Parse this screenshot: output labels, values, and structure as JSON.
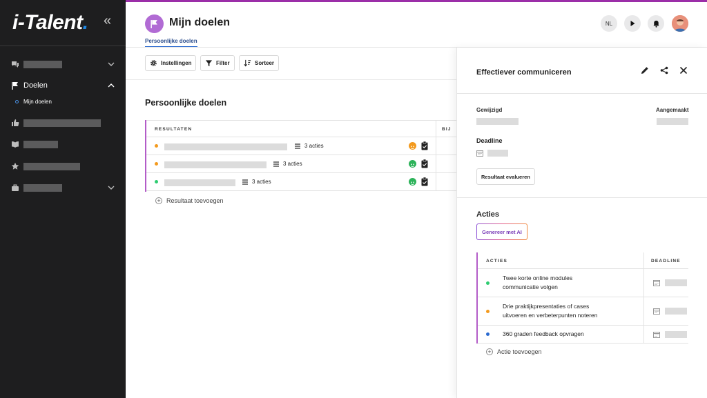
{
  "app": {
    "logo_text": "i-Talent",
    "logo_dot": "."
  },
  "sidebar": {
    "collapse_icon": "double-chevron-left",
    "items": [
      {
        "icon": "chat-icon",
        "label": "",
        "has_chevron": true
      },
      {
        "icon": "flag-icon",
        "label": "Doelen",
        "has_chevron": true,
        "expanded": true
      },
      {
        "icon": "thumbs-up-icon",
        "label": ""
      },
      {
        "icon": "book-icon",
        "label": ""
      },
      {
        "icon": "star-icon",
        "label": ""
      },
      {
        "icon": "briefcase-icon",
        "label": "",
        "has_chevron": true
      }
    ],
    "sub_item": "Mijn doelen"
  },
  "header": {
    "title": "Mijn doelen",
    "tab": "Persoonlijke doelen",
    "language": "NL"
  },
  "toolbar": {
    "settings_label": "Instellingen",
    "filter_label": "Filter",
    "sort_label": "Sorteer"
  },
  "main": {
    "section_title": "Persoonlijke doelen",
    "table": {
      "col_results": "RESULTATEN",
      "col_bij": "BIJ",
      "rows": [
        {
          "status_color": "#f39a1e",
          "actions": "3 acties",
          "smile_color": "#f39a1e"
        },
        {
          "status_color": "#f39a1e",
          "actions": "3 acties",
          "smile_color": "#2db35a"
        },
        {
          "status_color": "#2ecc71",
          "actions": "3 acties",
          "smile_color": "#2db35a"
        }
      ]
    },
    "add_result": "Resultaat toevoegen"
  },
  "panel": {
    "title": "Effectiever communiceren",
    "modified_label": "Gewijzigd",
    "created_label": "Aangemaakt",
    "deadline_label": "Deadline",
    "evaluate_button": "Resultaat evalueren",
    "actions_title": "Acties",
    "ai_button": "Genereer met AI",
    "table": {
      "col_actions": "ACTIES",
      "col_deadline": "DEADLINE",
      "rows": [
        {
          "status_color": "#2ecc71",
          "line1": "Twee korte online modules",
          "line2": "communicatie volgen"
        },
        {
          "status_color": "#f39a1e",
          "line1": "Drie praktijkpresentaties of cases",
          "line2": "uitvoeren en verbeterpunten noteren"
        },
        {
          "status_color": "#2b6ad0",
          "line1": "360 graden feedback opvragen",
          "line2": ""
        }
      ]
    },
    "add_action": "Actie toevoegen"
  },
  "colors": {
    "accent_purple": "#9b2ea8",
    "table_border": "#b35cc8",
    "sidebar_bg": "#1e1e1f",
    "tab_blue": "#2b6ad0"
  }
}
